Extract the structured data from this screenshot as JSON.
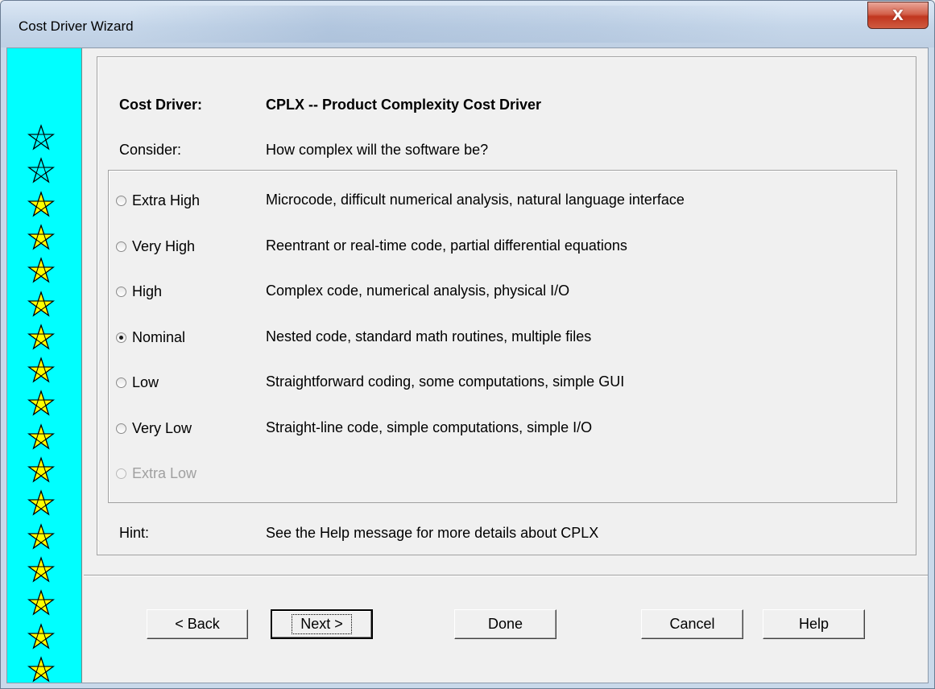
{
  "window": {
    "title": "Cost Driver Wizard",
    "close_glyph": "X"
  },
  "star_strip": {
    "background": "#00ffff",
    "outline_stars": 2,
    "filled_stars": 15,
    "filled_color": "#ffff00",
    "icon": "star-icon"
  },
  "header": {
    "driver_label": "Cost Driver:",
    "driver_value": "CPLX -- Product Complexity Cost Driver",
    "consider_label": "Consider:",
    "consider_value": "How complex will the software be?"
  },
  "options": [
    {
      "label": "Extra High",
      "description": "Microcode, difficult numerical analysis, natural language interface",
      "selected": false,
      "enabled": true
    },
    {
      "label": "Very High",
      "description": "Reentrant or real-time code, partial differential equations",
      "selected": false,
      "enabled": true
    },
    {
      "label": "High",
      "description": "Complex code, numerical analysis, physical I/O",
      "selected": false,
      "enabled": true
    },
    {
      "label": "Nominal",
      "description": "Nested code, standard math routines, multiple files",
      "selected": true,
      "enabled": true
    },
    {
      "label": "Low",
      "description": "Straightforward coding, some computations, simple GUI",
      "selected": false,
      "enabled": true
    },
    {
      "label": "Very Low",
      "description": "Straight-line code, simple computations, simple I/O",
      "selected": false,
      "enabled": true
    },
    {
      "label": "Extra Low",
      "description": "",
      "selected": false,
      "enabled": false
    }
  ],
  "hint": {
    "label": "Hint:",
    "value": "See the Help message for more details about CPLX"
  },
  "buttons": {
    "back": "< Back",
    "next": "Next >",
    "done": "Done",
    "cancel": "Cancel",
    "help": "Help"
  }
}
